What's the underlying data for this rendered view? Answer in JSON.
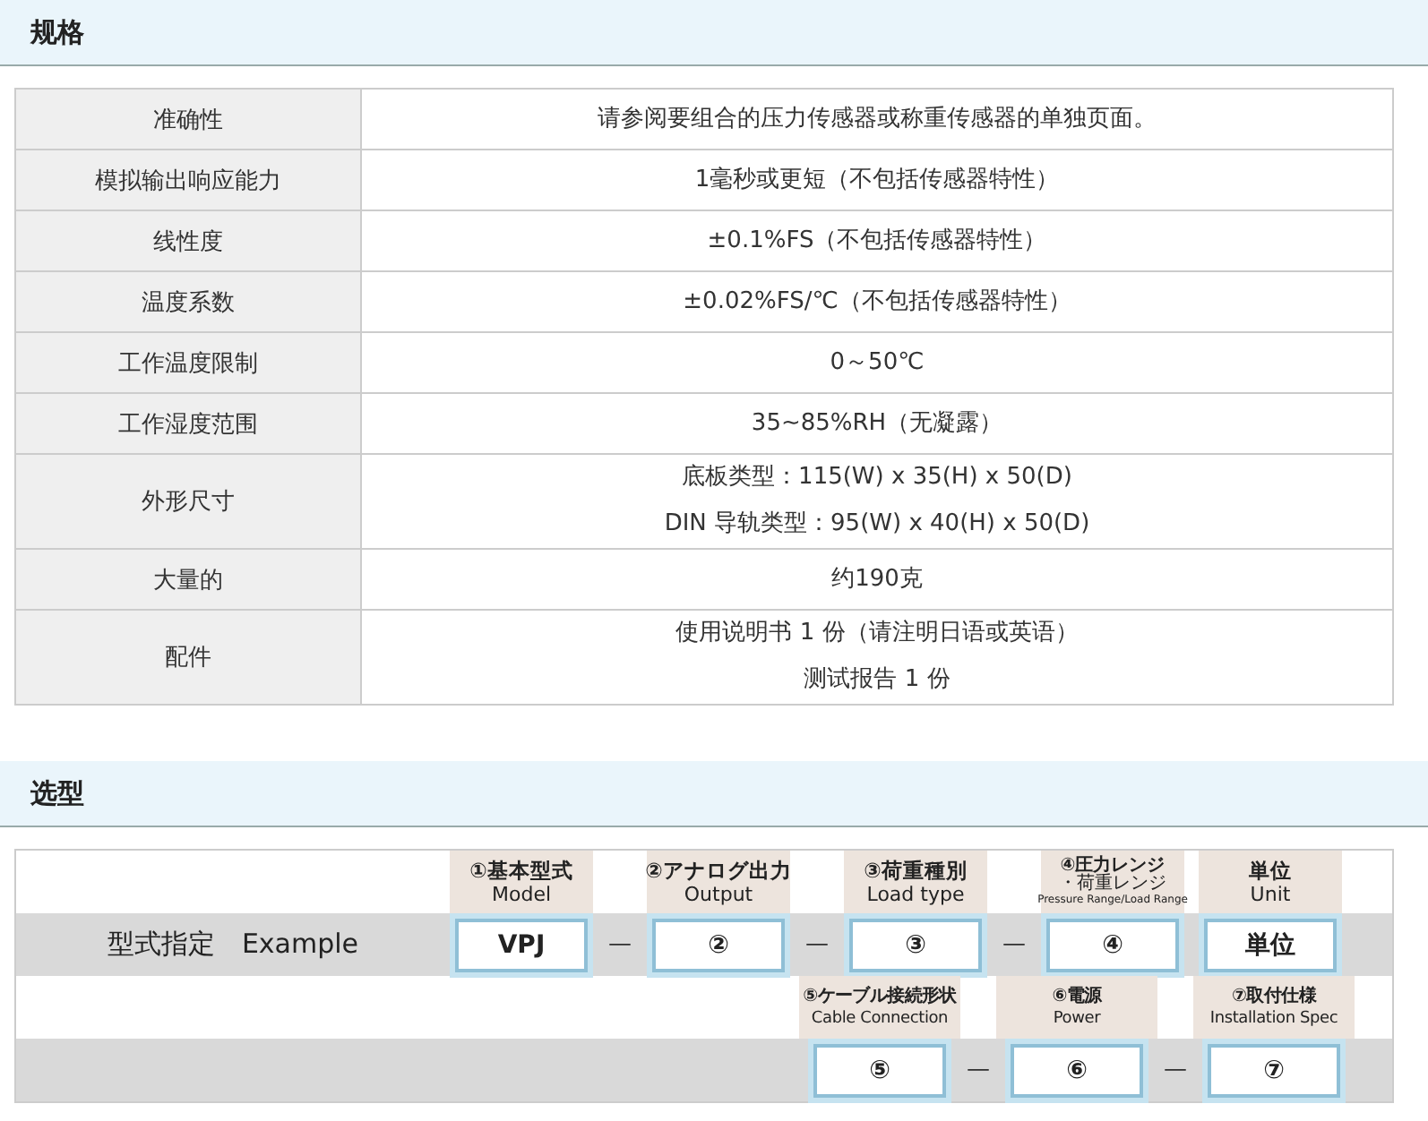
{
  "spec_section": {
    "title": "规格",
    "rows": [
      {
        "label": "准确性",
        "values": [
          "请参阅要组合的压力传感器或称重传感器的单独页面。"
        ]
      },
      {
        "label": "模拟输出响应能力",
        "values": [
          "1毫秒或更短（不包括传感器特性）"
        ]
      },
      {
        "label": "线性度",
        "values": [
          "±0.1%FS（不包括传感器特性）"
        ]
      },
      {
        "label": "温度系数",
        "values": [
          "±0.02%FS/℃（不包括传感器特性）"
        ]
      },
      {
        "label": "工作温度限制",
        "values": [
          "0～50℃"
        ]
      },
      {
        "label": "工作湿度范围",
        "values": [
          "35~85%RH（无凝露）"
        ]
      },
      {
        "label": "外形尺寸",
        "values": [
          "底板类型：115(W) x 35(H) x 50(D)",
          "DIN 导轨类型：95(W) x 40(H) x 50(D)"
        ]
      },
      {
        "label": "大量的",
        "values": [
          "约190克"
        ]
      },
      {
        "label": "配件",
        "values": [
          "使用说明书 1 份（请注明日语或英语）",
          "测试报告 1 份"
        ]
      }
    ]
  },
  "model_section": {
    "title": "选型",
    "label": "型式指定",
    "example": "Example",
    "lines": [
      [
        {
          "kind": "slot",
          "header": [
            "①基本型式",
            "Model"
          ],
          "code": "VPJ"
        },
        {
          "kind": "dash",
          "text": "—"
        },
        {
          "kind": "slot",
          "header": [
            "②アナログ出力",
            "Output"
          ],
          "code": "②"
        },
        {
          "kind": "dash",
          "text": "—"
        },
        {
          "kind": "slot",
          "header": [
            "③荷重種別",
            "Load type"
          ],
          "code": "③"
        },
        {
          "kind": "dash",
          "text": "—"
        },
        {
          "kind": "slot",
          "header": [
            "④圧力レンジ",
            "・荷重レンジ",
            "Pressure Range/Load Range"
          ],
          "code": "④"
        },
        {
          "kind": "gap"
        },
        {
          "kind": "slot",
          "header": [
            "単位",
            "Unit"
          ],
          "code": "単位"
        }
      ],
      [
        {
          "kind": "slot",
          "header": [
            "⑤ケーブル接続形状",
            "Cable Connection"
          ],
          "code": "⑤"
        },
        {
          "kind": "dash",
          "text": "—"
        },
        {
          "kind": "slot",
          "header": [
            "⑥電源",
            "Power"
          ],
          "code": "⑥"
        },
        {
          "kind": "dash",
          "text": "—"
        },
        {
          "kind": "slot",
          "header": [
            "⑦取付仕様",
            "Installation Spec"
          ],
          "code": "⑦"
        }
      ]
    ]
  }
}
